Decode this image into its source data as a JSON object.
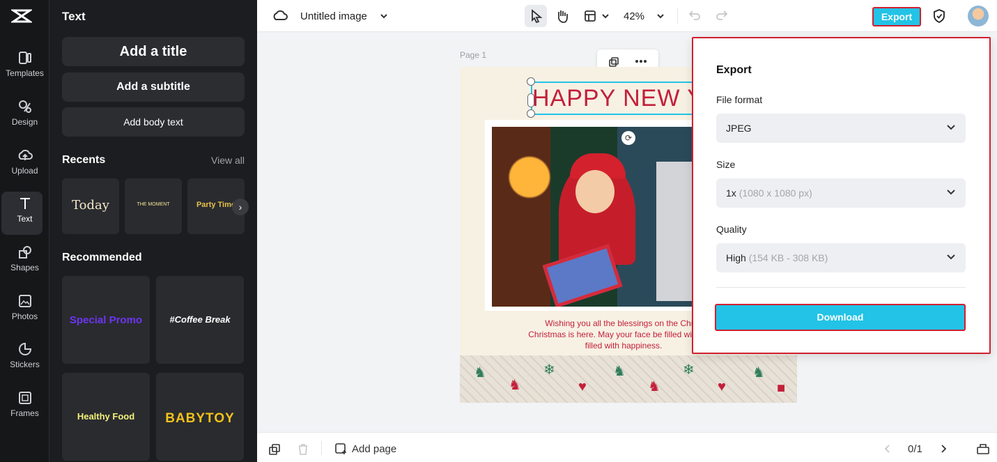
{
  "rail": {
    "items": [
      {
        "label": "Templates",
        "icon": "templates-icon"
      },
      {
        "label": "Design",
        "icon": "design-icon"
      },
      {
        "label": "Upload",
        "icon": "upload-icon"
      },
      {
        "label": "Text",
        "icon": "text-icon",
        "active": true
      },
      {
        "label": "Shapes",
        "icon": "shapes-icon"
      },
      {
        "label": "Photos",
        "icon": "photos-icon"
      },
      {
        "label": "Stickers",
        "icon": "stickers-icon"
      },
      {
        "label": "Frames",
        "icon": "frames-icon"
      }
    ]
  },
  "panel": {
    "title": "Text",
    "add_title": "Add a title",
    "add_subtitle": "Add a subtitle",
    "add_body": "Add body text",
    "recents_label": "Recents",
    "view_all": "View all",
    "recents": [
      "Today",
      "THE MOMENT",
      "Party Time"
    ],
    "recommended_label": "Recommended",
    "recommended": [
      "Special Promo",
      "#Coffee Break",
      "Healthy Food",
      "BABYTOY"
    ]
  },
  "topbar": {
    "doc_title": "Untitled image",
    "zoom": "42%",
    "export_label": "Export"
  },
  "canvas": {
    "page_label": "Page 1",
    "headline": "HAPPY NEW YE",
    "greeting_lines": [
      "Wishing you all the blessings on the Christ",
      "Christmas is here. May your face be filled with joy a",
      "filled with happiness."
    ]
  },
  "bottombar": {
    "add_page": "Add page",
    "pagination": "0/1"
  },
  "export_panel": {
    "title": "Export",
    "file_format_label": "File format",
    "file_format_value": "JPEG",
    "size_label": "Size",
    "size_value": "1x",
    "size_detail": "(1080 x 1080 px)",
    "quality_label": "Quality",
    "quality_value": "High",
    "quality_detail": "(154 KB - 308 KB)",
    "download_label": "Download"
  },
  "colors": {
    "accent": "#22c3e6",
    "highlight_border": "#d0202f",
    "headline": "#c3203a"
  }
}
